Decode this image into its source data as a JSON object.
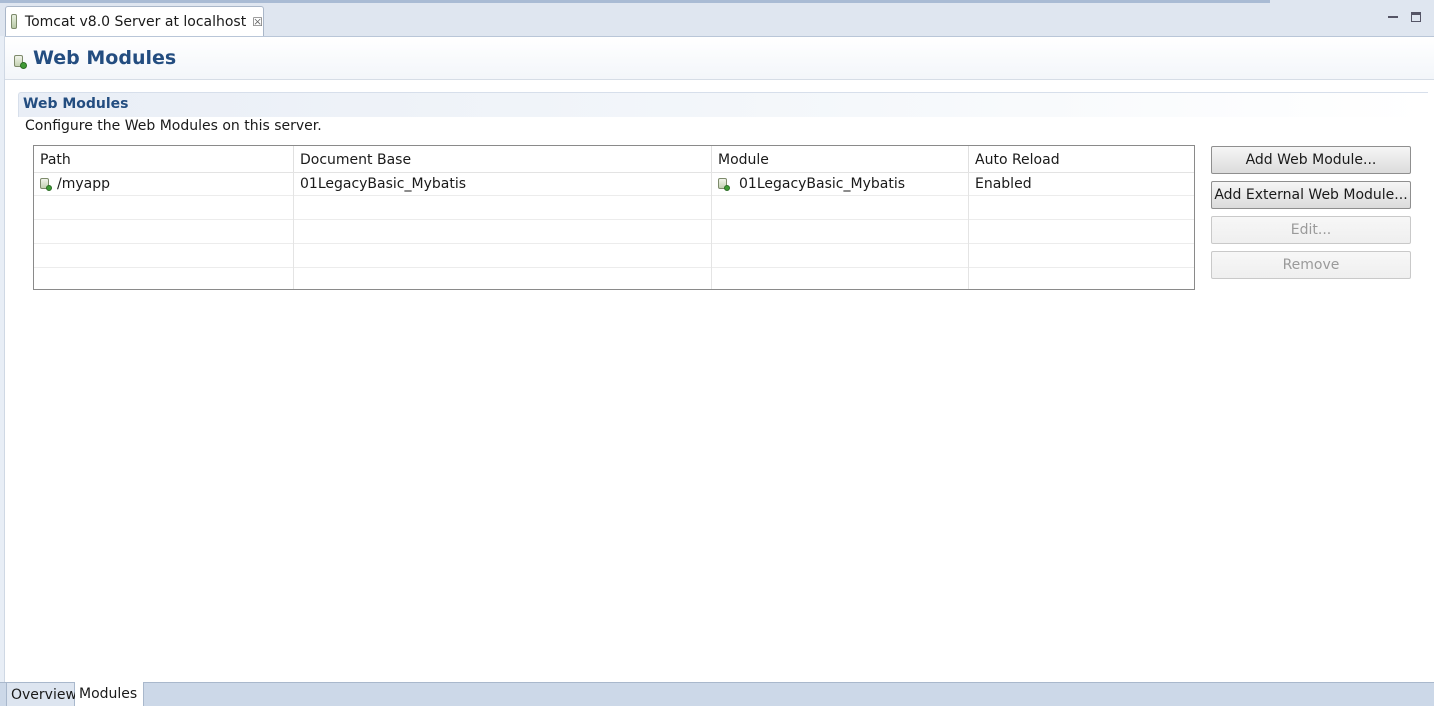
{
  "editor_tab": {
    "title": "Tomcat v8.0 Server at localhost",
    "close_glyph": "☒",
    "icon": "server-icon"
  },
  "form": {
    "title": "Web Modules",
    "icon": "server-module-icon"
  },
  "section": {
    "title": "Web Modules",
    "description": "Configure the Web Modules on this server."
  },
  "table": {
    "columns": [
      "Path",
      "Document Base",
      "Module",
      "Auto Reload"
    ],
    "rows": [
      {
        "path": "/myapp",
        "document_base": "01LegacyBasic_Mybatis",
        "module": "01LegacyBasic_Mybatis",
        "auto_reload": "Enabled"
      }
    ]
  },
  "buttons": {
    "add_web_module": "Add Web Module...",
    "add_external_web_module": "Add External Web Module...",
    "edit": "Edit...",
    "remove": "Remove"
  },
  "bottom_tabs": {
    "overview": "Overview",
    "modules": "Modules",
    "active": "Modules"
  },
  "colors": {
    "title_blue": "#234d80",
    "tabbar_bg": "#dfe6f0",
    "bottom_bar_bg": "#ccd8e8"
  }
}
